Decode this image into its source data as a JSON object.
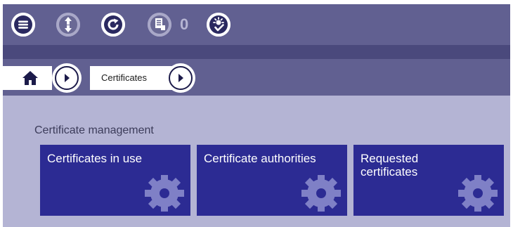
{
  "toolbar": {
    "buttons": [
      {
        "icon": "menu-icon"
      },
      {
        "icon": "up-down-arrows-icon"
      },
      {
        "icon": "refresh-icon"
      },
      {
        "icon": "pending-documents-icon"
      },
      {
        "icon": "settings-check-icon"
      }
    ],
    "pending_count": "0"
  },
  "breadcrumb": {
    "home_icon": "home-icon",
    "items": [
      {
        "label": "Certificates"
      }
    ]
  },
  "content": {
    "section_title": "Certificate management",
    "tiles": [
      {
        "label": "Certificates in use",
        "icon": "gear-icon"
      },
      {
        "label": "Certificate authorities",
        "icon": "gear-icon"
      },
      {
        "label": "Requested certificates",
        "icon": "gear-icon"
      }
    ]
  },
  "colors": {
    "toolbar_bg": "#616091",
    "band_bg": "#4a497c",
    "content_bg": "#b4b4d4",
    "tile_bg": "#2c2b93",
    "gear": "#7f80c6"
  }
}
